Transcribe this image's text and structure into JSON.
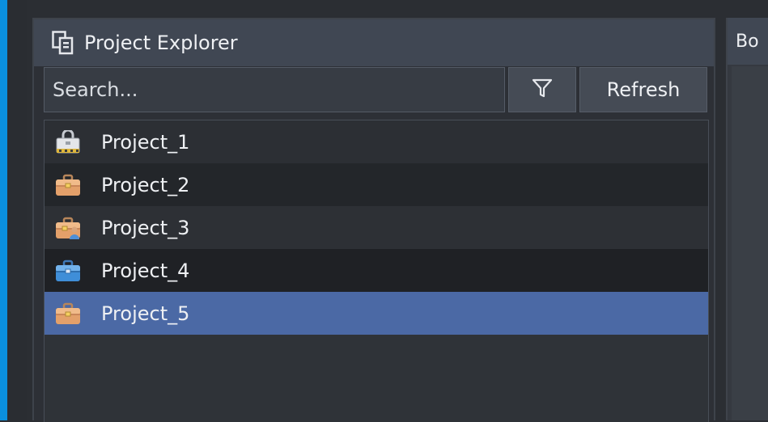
{
  "explorer": {
    "title": "Project Explorer",
    "title_icon": "project-explorer-icon",
    "search": {
      "placeholder": "Search...",
      "value": ""
    },
    "filter_icon": "filter-icon",
    "refresh_label": "Refresh"
  },
  "projects": [
    {
      "label": "Project_1",
      "icon": "locked-briefcase-icon",
      "selected": false
    },
    {
      "label": "Project_2",
      "icon": "briefcase-orange-icon",
      "selected": false
    },
    {
      "label": "Project_3",
      "icon": "briefcase-user-icon",
      "selected": false
    },
    {
      "label": "Project_4",
      "icon": "briefcase-blue-icon",
      "selected": false
    },
    {
      "label": "Project_5",
      "icon": "briefcase-orange-icon",
      "selected": true
    }
  ],
  "right_panel": {
    "title": "Bo"
  },
  "colors": {
    "accent": "#0a8fde",
    "selection": "#4b69a5",
    "header": "#404753"
  }
}
